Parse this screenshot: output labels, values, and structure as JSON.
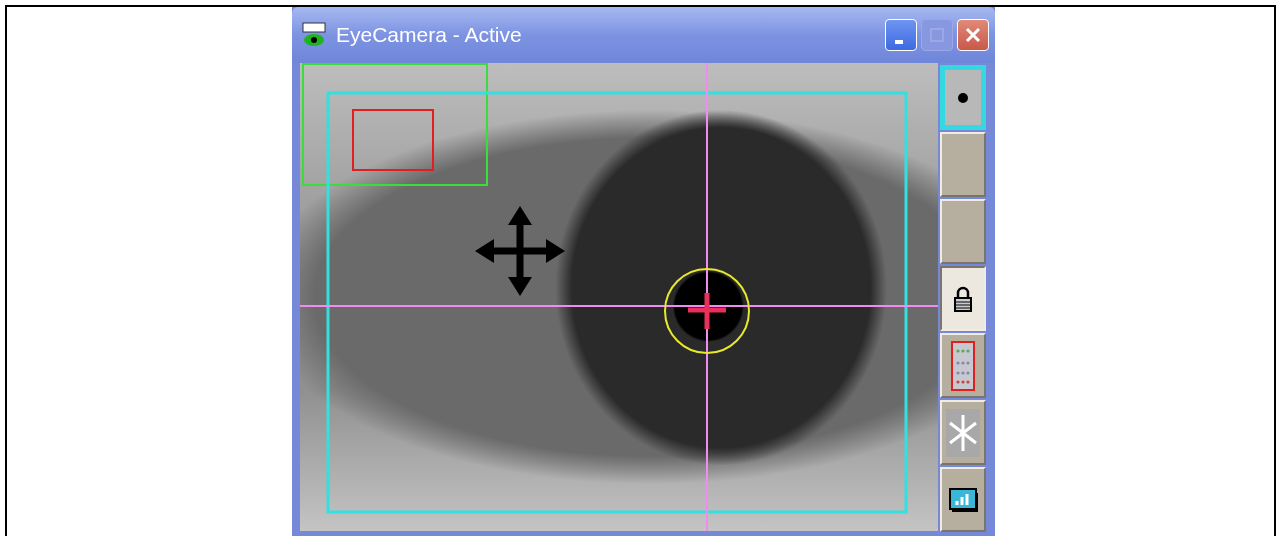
{
  "window": {
    "title": "EyeCamera - Active"
  },
  "title_buttons": [
    {
      "kind": "minimize",
      "disabled": false
    },
    {
      "kind": "maximize",
      "disabled": true
    },
    {
      "kind": "close",
      "disabled": false
    }
  ],
  "toolbar": [
    {
      "kind": "dot",
      "selected": true,
      "pressed": false
    },
    {
      "kind": "blank",
      "selected": false,
      "pressed": false
    },
    {
      "kind": "blank",
      "selected": false,
      "pressed": false
    },
    {
      "kind": "lock",
      "selected": false,
      "pressed": true
    },
    {
      "kind": "grid",
      "selected": false,
      "pressed": false
    },
    {
      "kind": "freeze",
      "selected": false,
      "pressed": false
    },
    {
      "kind": "chart",
      "selected": false,
      "pressed": false
    }
  ]
}
